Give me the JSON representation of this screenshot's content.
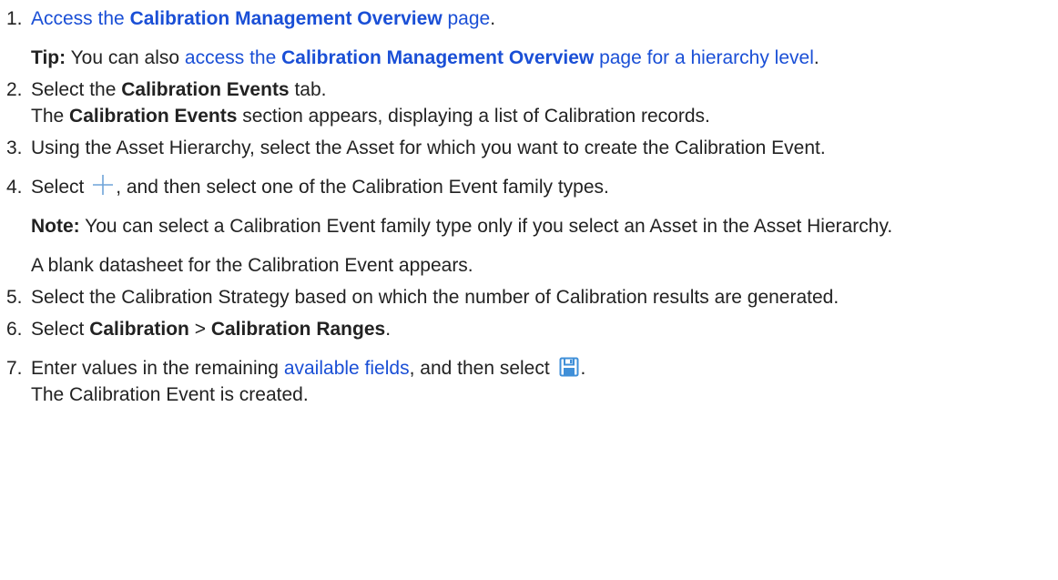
{
  "steps": [
    {
      "num": "1.",
      "text_before": "",
      "link_pre": "Access the ",
      "link_bold": "Calibration Management Overview",
      "link_post": " page",
      "text_after": ".",
      "tip_label": "Tip:",
      "tip_text": " You can also ",
      "tip_link_pre": "access the ",
      "tip_link_bold": "Calibration Management Overview",
      "tip_link_post": " page for a hierarchy level",
      "tip_end": "."
    },
    {
      "num": "2.",
      "pre": "Select the ",
      "bold": "Calibration Events",
      "post": " tab.",
      "result_pre": "The ",
      "result_bold": "Calibration Events",
      "result_post": " section appears, displaying a list of Calibration records."
    },
    {
      "num": "3.",
      "text": "Using the Asset Hierarchy, select the Asset for which you want to create the Calibration Event."
    },
    {
      "num": "4.",
      "pre": "Select ",
      "icon": "plus-icon",
      "post": ", and then select one of the Calibration Event family types.",
      "note_label": "Note:",
      "note_text": " You can select a Calibration Event family type only if you select an Asset in the Asset Hierarchy.",
      "result": "A blank datasheet for the Calibration Event appears."
    },
    {
      "num": "5.",
      "text": "Select the Calibration Strategy based on which the number of Calibration results are generated."
    },
    {
      "num": "6.",
      "pre": "Select ",
      "bold1": "Calibration",
      "sep": " > ",
      "bold2": "Calibration Ranges",
      "post": "."
    },
    {
      "num": "7.",
      "pre": "Enter values in the remaining ",
      "link": "available fields",
      "mid": ", and then select ",
      "icon": "save-icon",
      "post": ".",
      "result": "The Calibration Event is created."
    }
  ],
  "colors": {
    "link": "#1a4fd6",
    "plus_icon": "#6fa3d8",
    "save_icon": "#3f8fd8"
  }
}
